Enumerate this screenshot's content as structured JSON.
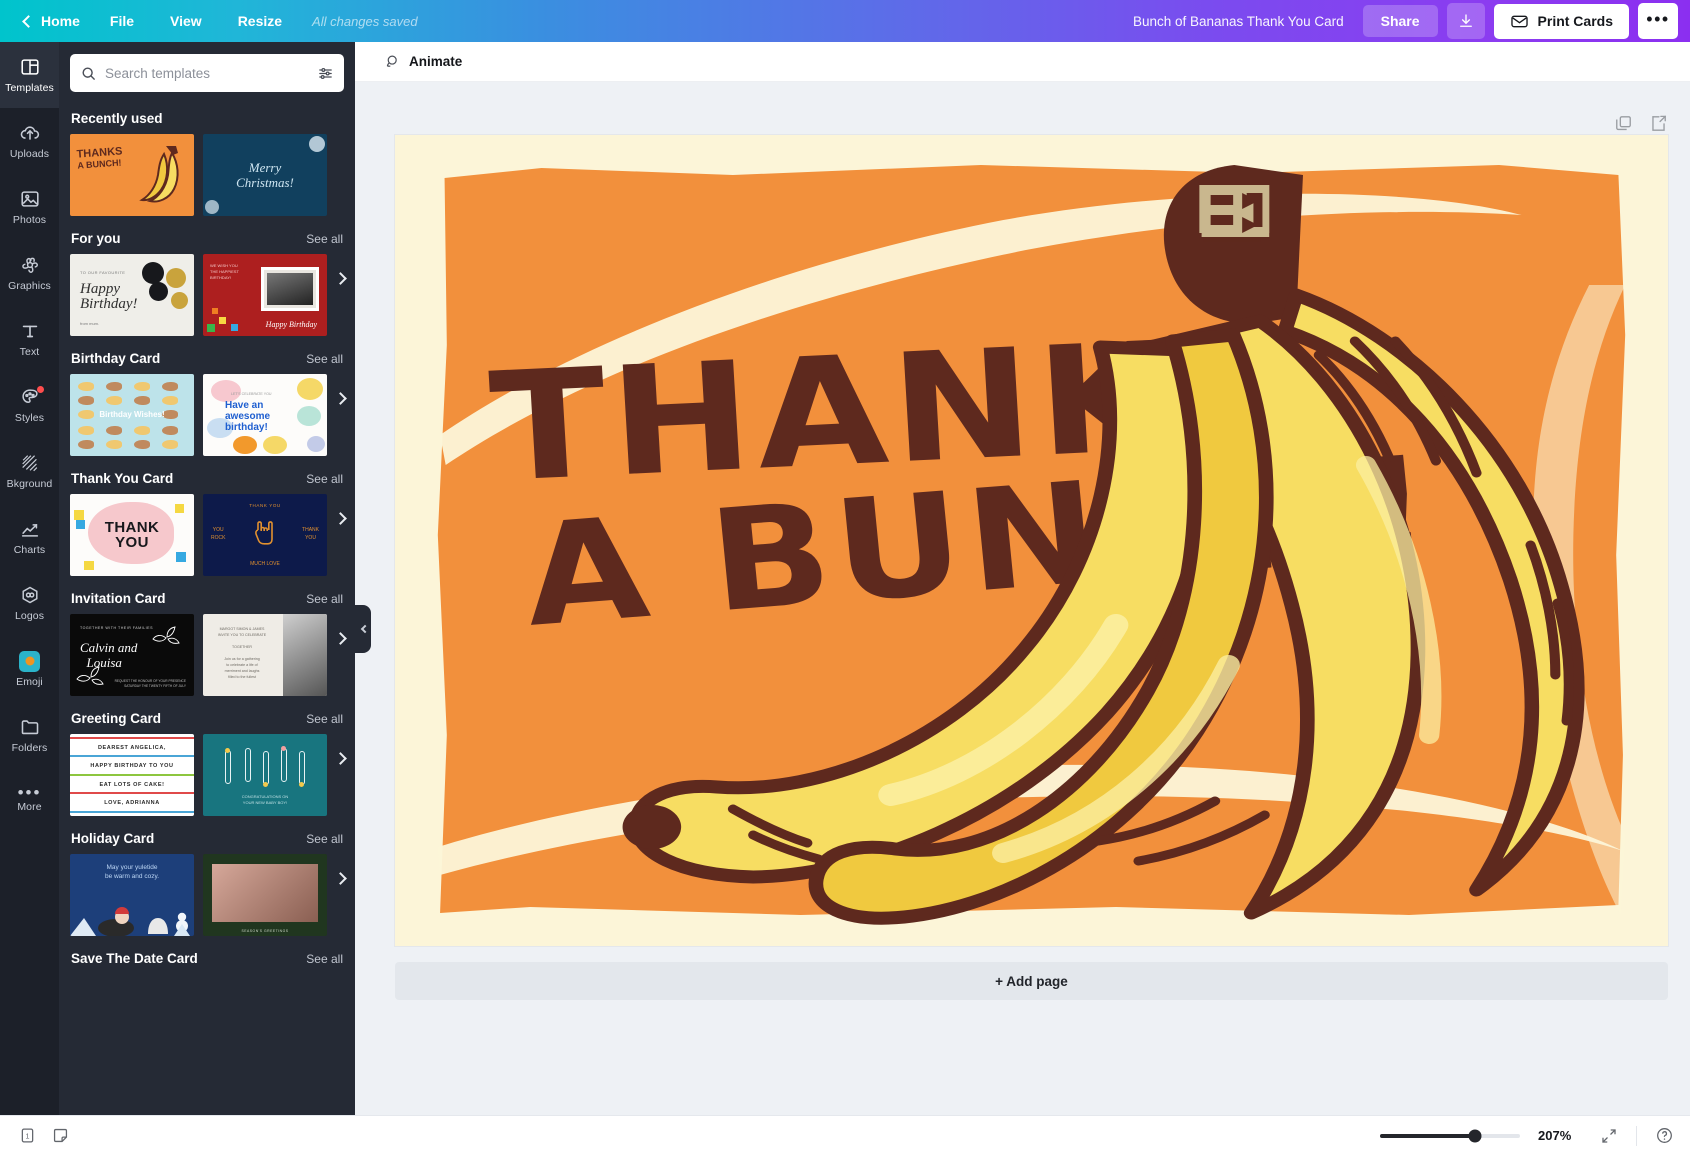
{
  "topbar": {
    "home_label": "Home",
    "menu": [
      "File",
      "View",
      "Resize"
    ],
    "save_status": "All changes saved",
    "doc_title": "Bunch of Bananas Thank You Card",
    "share_label": "Share",
    "download_icon": "download-icon",
    "print_label": "Print Cards",
    "print_icon": "envelope-icon",
    "more_label": "•••"
  },
  "rail": {
    "items": [
      {
        "label": "Templates",
        "icon": "templates-icon",
        "active": true,
        "badge": false
      },
      {
        "label": "Uploads",
        "icon": "upload-cloud-icon",
        "active": false,
        "badge": false
      },
      {
        "label": "Photos",
        "icon": "photo-icon",
        "active": false,
        "badge": false
      },
      {
        "label": "Graphics",
        "icon": "graphics-icon",
        "active": false,
        "badge": false
      },
      {
        "label": "Text",
        "icon": "text-icon",
        "active": false,
        "badge": false
      },
      {
        "label": "Styles",
        "icon": "styles-palette-icon",
        "active": false,
        "badge": true
      },
      {
        "label": "Bkground",
        "icon": "background-icon",
        "active": false,
        "badge": false
      },
      {
        "label": "Charts",
        "icon": "chart-line-icon",
        "active": false,
        "badge": false
      },
      {
        "label": "Logos",
        "icon": "logos-icon",
        "active": false,
        "badge": false
      },
      {
        "label": "Emoji",
        "icon": "emoji-icon",
        "active": false,
        "badge": false
      },
      {
        "label": "Folders",
        "icon": "folder-icon",
        "active": false,
        "badge": false
      },
      {
        "label": "More",
        "icon": "more-dots-icon",
        "active": false,
        "badge": false
      }
    ]
  },
  "panel": {
    "search": {
      "placeholder": "Search templates",
      "value": "",
      "icon": "search-icon",
      "filter_icon": "filter-sliders-icon"
    },
    "see_all_label": "See all",
    "sections": [
      {
        "title": "Recently used",
        "has_see_all": false,
        "thumbs": [
          {
            "name": "thanks-a-bunch-card",
            "line1": "THANKS",
            "line2": "A BUNCH!"
          },
          {
            "name": "merry-christmas-card",
            "line1": "Merry",
            "line2": "Christmas!"
          }
        ]
      },
      {
        "title": "For you",
        "has_see_all": true,
        "thumbs": [
          {
            "name": "happy-birthday-balloons-card",
            "line1": "Happy",
            "line2": "Birthday!",
            "top": "TO OUR FAVOURITE",
            "bottom": "from mum."
          },
          {
            "name": "happy-birthday-photo-card",
            "line1": "Happy Birthday",
            "top": "WE WISH YOU\nTHE HAPPIEST\nBIRTHDAY!"
          }
        ]
      },
      {
        "title": "Birthday Card",
        "has_see_all": true,
        "thumbs": [
          {
            "name": "birthday-wishes-fish-card",
            "line1": "Birthday Wishes!"
          },
          {
            "name": "have-an-awesome-birthday-card",
            "line1": "Have an",
            "line2": "awesome",
            "line3": "birthday!",
            "top": "LET'S CELEBRATE YOU"
          }
        ]
      },
      {
        "title": "Thank You Card",
        "has_see_all": true,
        "thumbs": [
          {
            "name": "thank-you-pink-blob-card",
            "line1": "THANK",
            "line2": "YOU"
          },
          {
            "name": "thank-you-rock-hand-card",
            "top": "THANK YOU",
            "left": "YOU\nROCK",
            "right": "THANK\nYOU",
            "bottom": "MUCH LOVE"
          }
        ]
      },
      {
        "title": "Invitation Card",
        "has_see_all": true,
        "thumbs": [
          {
            "name": "calvin-and-louisa-invitation-card",
            "top": "TOGETHER WITH THEIR FAMILIES",
            "line1": "Calvin and",
            "line2": "Louisa",
            "bottom": "REQUEST THE HONOUR OF YOUR PRESENCE\nSATURDAY THE TWENTY FIFTH OF JULY"
          },
          {
            "name": "gathering-invitation-card",
            "body": "MARGOT SIMON & JAMES\nINVITE YOU TO CELEBRATE\n\nTOGETHER\n\nJoin us for a gathering\nto celebrate a life of\nmerriment and laughs\nfilled to the fullest"
          }
        ]
      },
      {
        "title": "Greeting Card",
        "has_see_all": true,
        "thumbs": [
          {
            "name": "dearest-angelica-greeting-card",
            "r1": "DEAREST ANGELICA,",
            "r2": "HAPPY BIRTHDAY TO YOU",
            "r3": "EAT LOTS OF CAKE!",
            "r4": "LOVE, ADRIANNA"
          },
          {
            "name": "safety-pins-greeting-card",
            "caption": "CONGRATULATIONS ON\nYOUR NEW BABY BOY!"
          }
        ]
      },
      {
        "title": "Holiday Card",
        "has_see_all": true,
        "thumbs": [
          {
            "name": "yuletide-holiday-card",
            "line1": "May your yuletide",
            "line2": "be warm and cozy."
          },
          {
            "name": "family-photo-holiday-card",
            "caption": "SEASON'S GREETINGS"
          }
        ]
      },
      {
        "title": "Save The Date Card",
        "has_see_all": true,
        "thumbs": []
      }
    ]
  },
  "editor": {
    "animate_label": "Animate",
    "animate_icon": "animate-icon",
    "duplicate_icon": "duplicate-page-icon",
    "export_page_icon": "export-page-icon",
    "add_page_label": "+ Add page"
  },
  "artwork": {
    "name": "bunch-of-bananas-thank-you-card",
    "line1": "THANKS",
    "line2": "A BUNCH!",
    "colors": {
      "paper": "#fcf5d8",
      "orange": "#f2903c",
      "brown": "#5e291e",
      "banana": "#f7dd62",
      "banana_shade": "#f0c93f",
      "stem_tan": "#c9b78e"
    }
  },
  "bottombar": {
    "page_number": "1",
    "page_icon": "page-thumbnail-icon",
    "notes_icon": "notes-icon",
    "zoom_value": "207%",
    "zoom_slider_percent": 68,
    "fullscreen_icon": "fullscreen-icon",
    "help_icon": "help-icon"
  }
}
